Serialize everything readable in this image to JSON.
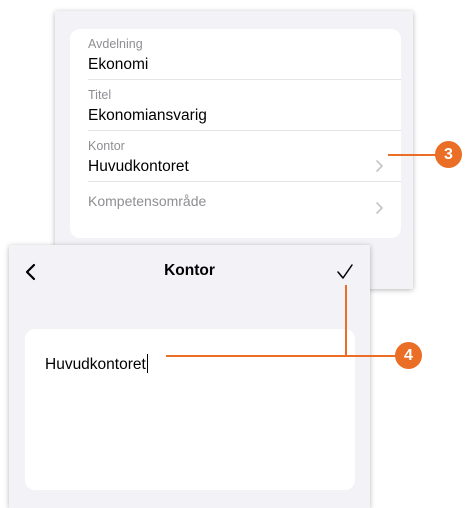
{
  "profile_form": {
    "fields": [
      {
        "label": "Avdelning",
        "value": "Ekonomi"
      },
      {
        "label": "Titel",
        "value": "Ekonomiansvarig"
      },
      {
        "label": "Kontor",
        "value": "Huvudkontoret"
      },
      {
        "label": "Kompetensområde",
        "value": ""
      }
    ]
  },
  "editor": {
    "title": "Kontor",
    "back_icon": "chevron-left-icon",
    "done_icon": "checkmark-icon",
    "input_value": "Huvudkontoret"
  },
  "callouts": [
    {
      "number": "3"
    },
    {
      "number": "4"
    }
  ],
  "colors": {
    "accent": "#ea6e25",
    "background": "#f2f2f7",
    "secondary_text": "#8e8e93",
    "chevron": "#c4c4c7"
  }
}
